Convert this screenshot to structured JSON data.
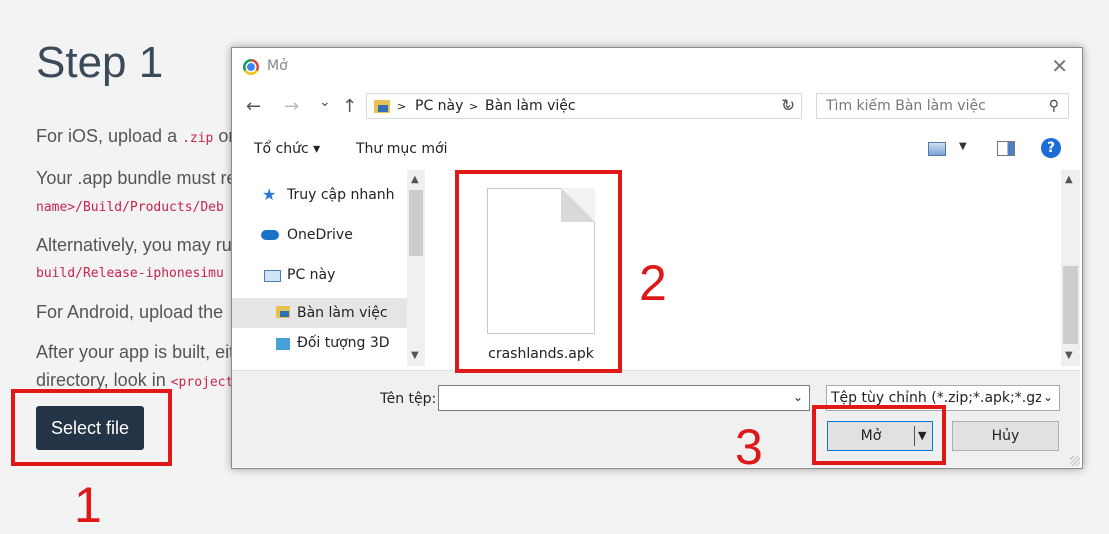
{
  "page": {
    "step_title": "Step 1",
    "para1": {
      "a": "For iOS, upload a ",
      "code": ".zip",
      "b": " or"
    },
    "para2": "Your .app bundle must re",
    "code2": "name>/Build/Products/Deb",
    "para3": "Alternatively, you may run",
    "code3": "build/Release-iphonesimu",
    "para4": {
      "a": "For Android, upload the ",
      "code": "."
    },
    "para5": "After your app is built, eith",
    "para6": {
      "a": "directory, look in ",
      "code": "<project"
    },
    "select_button": "Select file"
  },
  "annotations": [
    "1",
    "2",
    "3"
  ],
  "dialog": {
    "title": "Mở",
    "close_glyph": "✕",
    "nav": {
      "back": "←",
      "forward": "→",
      "recent": "⌄",
      "up": "↑"
    },
    "breadcrumb": [
      "PC này",
      "Bàn làm việc"
    ],
    "breadcrumb_sep": ">",
    "address_dropdown": "⌄",
    "refresh_glyph": "↻",
    "search_placeholder": "Tìm kiếm Bàn làm việc",
    "search_glyph": "⚲",
    "toolbar": {
      "organize": "Tổ chức ▾",
      "new_folder": "Thư mục mới",
      "view_dd": "▼",
      "help": "?"
    },
    "sidebar": [
      {
        "label": "Truy cập nhanh",
        "icon": "star-icon"
      },
      {
        "label": "OneDrive",
        "icon": "cloud-icon"
      },
      {
        "label": "PC này",
        "icon": "computer-icon"
      },
      {
        "label": "Bàn làm việc",
        "icon": "desktop-folder-icon",
        "selected": true
      },
      {
        "label": "Đối tượng 3D",
        "icon": "folder-icon"
      }
    ],
    "scroll": {
      "up": "▲",
      "down": "▼"
    },
    "file": {
      "name": "crashlands.apk",
      "icon": "file-icon"
    },
    "file_name_label": "Tên tệp:",
    "file_name_value": "",
    "file_type": "Tệp tùy chỉnh (*.zip;*.apk;*.gz;*.t",
    "open_button": "Mở",
    "cancel_button": "Hủy"
  },
  "colors": {
    "annotation": "#e01818",
    "select_button_bg": "#243447",
    "code": "#c7254e"
  }
}
